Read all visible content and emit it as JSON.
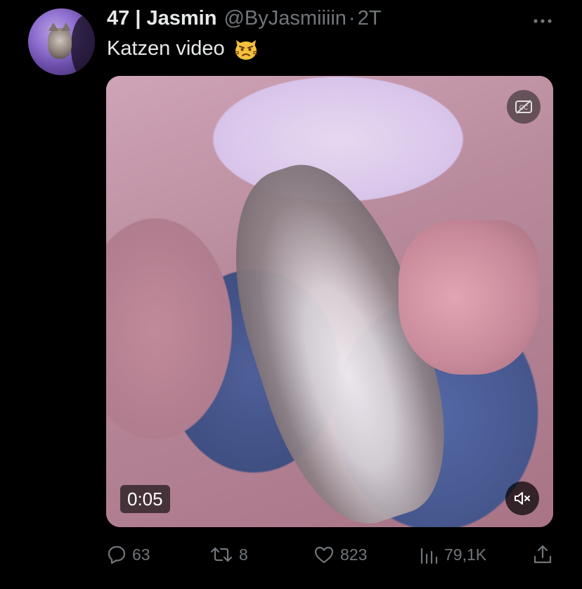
{
  "author": {
    "name": "47 | Jasmin",
    "handle": "@ByJasmiiiin",
    "separator": "·",
    "time": "2T"
  },
  "more_icon": "more-horizontal-icon",
  "tweet": {
    "text": "Katzen video",
    "emoji": "pouting-cat-emoji"
  },
  "media": {
    "type": "video",
    "timestamp": "0:05",
    "captions_icon": "captions-off-icon",
    "mute_icon": "volume-muted-icon"
  },
  "actions": {
    "replies": "63",
    "retweets": "8",
    "likes": "823",
    "views": "79,1K"
  },
  "colors": {
    "background": "#000000",
    "text_primary": "#e7e9ea",
    "text_secondary": "#71767b"
  }
}
